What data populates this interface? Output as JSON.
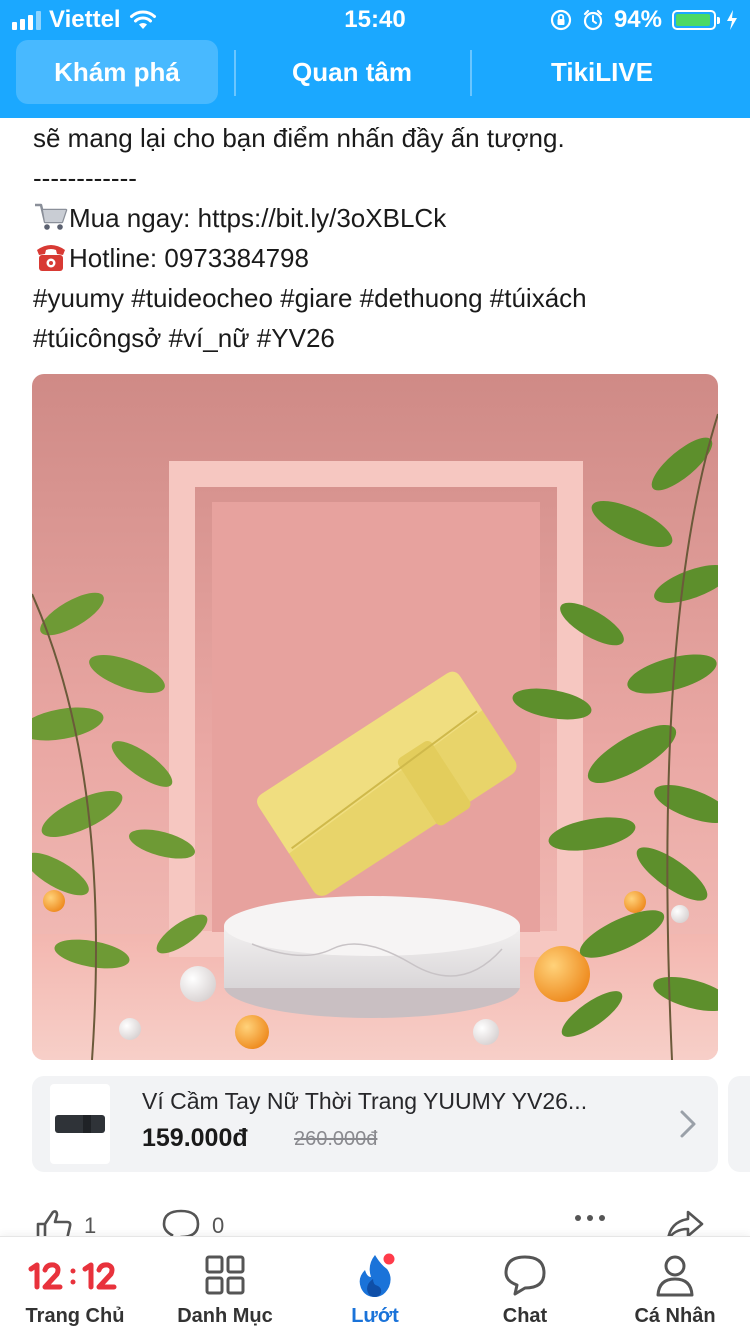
{
  "status_bar": {
    "carrier": "Viettel",
    "time": "15:40",
    "battery_percent": "94%",
    "battery_level": 0.94,
    "icons": [
      "signal-icon",
      "wifi-icon",
      "orientation-lock-icon",
      "alarm-icon",
      "battery-icon",
      "charging-icon"
    ]
  },
  "top_tabs": [
    {
      "label": "Khám phá",
      "active": true
    },
    {
      "label": "Quan tâm",
      "active": false
    },
    {
      "label": "TikiLIVE",
      "active": false
    }
  ],
  "post": {
    "lines": {
      "intro": "sẽ mang lại cho bạn điểm nhấn đầy ấn tượng.",
      "separator": "------------",
      "buy": "Mua ngay: https://bit.ly/3oXBLCk",
      "hotline": "Hotline: 0973384798",
      "tags1": "#yuumy #tuideocheo #giare #dethuong #túixách",
      "tags2": "#túicôngsở #ví_nữ #YV26"
    },
    "buy_icon": "shopping-cart-icon",
    "hotline_icon": "telephone-icon"
  },
  "media": {
    "description_icon": "product-photo",
    "colors": {
      "background": "#e9a6a1",
      "wallet": "#ecd873",
      "leaf": "#5d8f2c",
      "orange": "#f2992c"
    }
  },
  "product": {
    "title": "Ví Cầm Tay Nữ Thời Trang YUUMY YV26...",
    "price": "159.000đ",
    "old_price": "260.000đ"
  },
  "actions": {
    "likes": "1",
    "comments": "0"
  },
  "bottom_nav": [
    {
      "label": "Trang Chủ",
      "icon": "12-12-sale-icon",
      "active": false
    },
    {
      "label": "Danh Mục",
      "icon": "grid-icon",
      "active": false
    },
    {
      "label": "Lướt",
      "icon": "flame-icon",
      "active": true
    },
    {
      "label": "Chat",
      "icon": "chat-bubble-icon",
      "active": false
    },
    {
      "label": "Cá Nhân",
      "icon": "user-icon",
      "active": false
    }
  ],
  "colors": {
    "brand_blue": "#1ba8ff",
    "active_nav": "#1a73d9",
    "sale_red": "#e8323c"
  }
}
